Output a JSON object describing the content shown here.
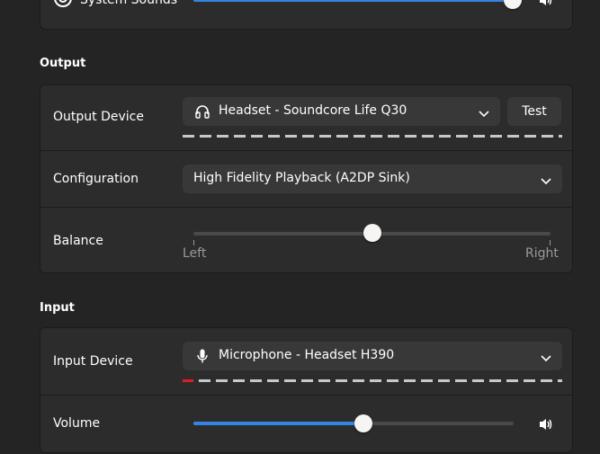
{
  "sounds": {
    "system_sounds_label": "System Sounds",
    "system_sounds_volume_pct": 100
  },
  "output": {
    "title": "Output",
    "device_label": "Output Device",
    "device_value": "Headset - Soundcore Life Q30",
    "test_label": "Test",
    "config_label": "Configuration",
    "config_value": "High Fidelity Playback (A2DP Sink)",
    "balance_label": "Balance",
    "balance_left": "Left",
    "balance_right": "Right",
    "balance_pct": 50
  },
  "input": {
    "title": "Input",
    "device_label": "Input Device",
    "device_value": "Microphone - Headset H390",
    "volume_label": "Volume",
    "volume_pct": 53
  },
  "colors": {
    "accent": "#3584e4",
    "level_indicator": "#e01b24",
    "background": "#242424",
    "card": "#2c2c2c",
    "button": "#383838"
  },
  "icons": {
    "system_sounds": "system-sounds-icon",
    "output_device": "headphones-icon",
    "input_device": "microphone-icon",
    "volume": "speaker-icon",
    "dropdown": "chevron-down-icon"
  }
}
